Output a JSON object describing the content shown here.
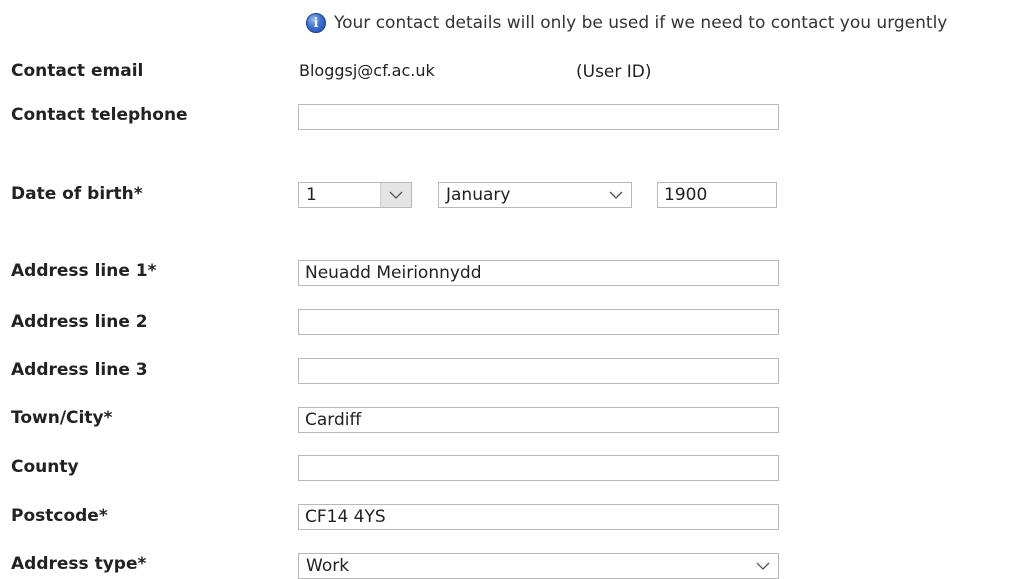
{
  "info": {
    "icon": "info-icon",
    "text": "Your contact details will only be used if we need to contact you urgently"
  },
  "contact_email": {
    "label": "Contact email",
    "value": "Bloggsj@cf.ac.uk",
    "note": "(User ID)"
  },
  "contact_telephone": {
    "label": "Contact telephone",
    "value": ""
  },
  "date_of_birth": {
    "label": "Date of birth*",
    "day": "1",
    "month": "January",
    "year": "1900"
  },
  "address_line_1": {
    "label": "Address line 1*",
    "value": "Neuadd Meirionnydd"
  },
  "address_line_2": {
    "label": "Address line 2",
    "value": ""
  },
  "address_line_3": {
    "label": "Address line 3",
    "value": ""
  },
  "town_city": {
    "label": "Town/City*",
    "value": "Cardiff"
  },
  "county": {
    "label": "County",
    "value": ""
  },
  "postcode": {
    "label": "Postcode*",
    "value": "CF14 4YS"
  },
  "address_type": {
    "label": "Address type*",
    "value": "Work"
  }
}
